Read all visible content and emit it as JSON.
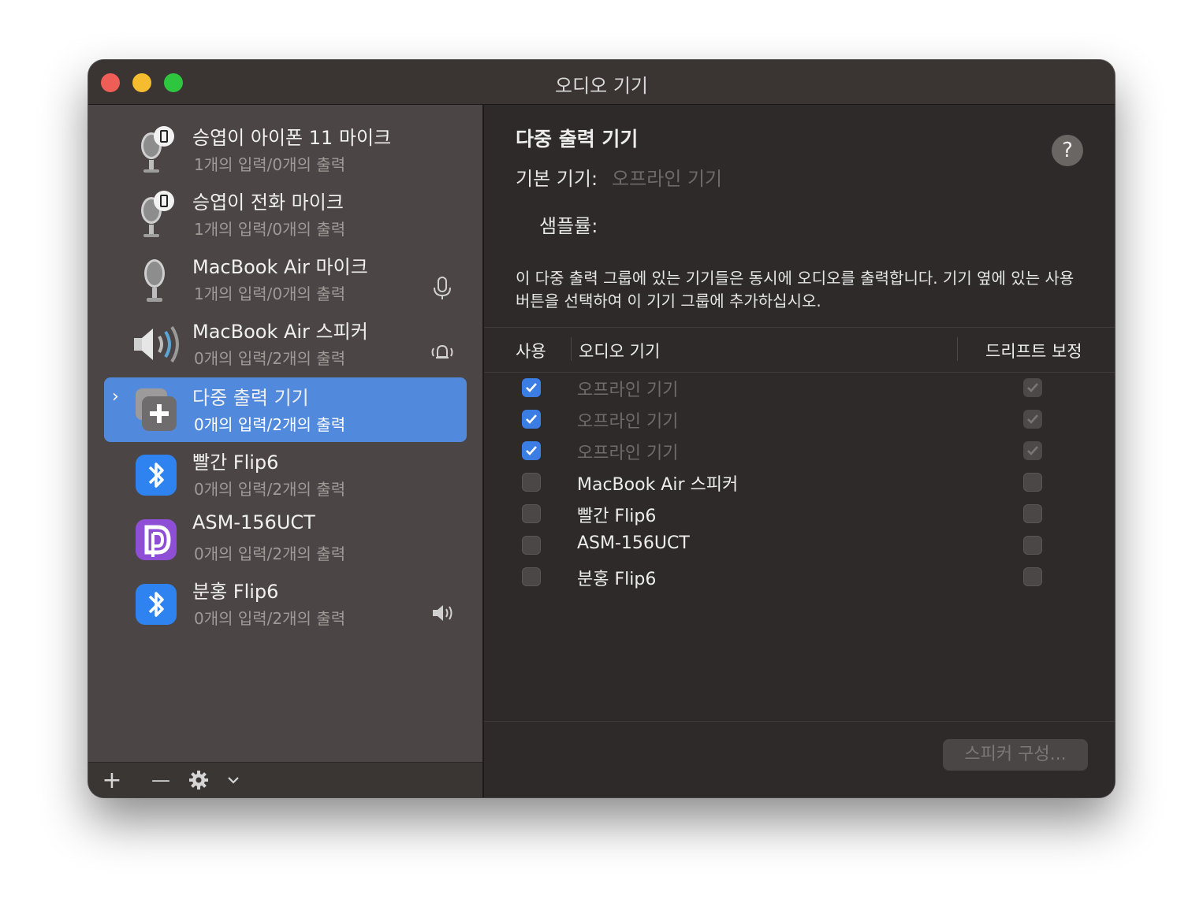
{
  "window": {
    "title": "오디오 기기"
  },
  "sidebar": {
    "devices": [
      {
        "name": "승엽이 아이폰 11 마이크",
        "io": "1개의 입력/0개의 출력",
        "icon": "iphone-microphone-icon"
      },
      {
        "name": "승엽이 전화 마이크",
        "io": "1개의 입력/0개의 출력",
        "icon": "iphone-microphone-icon"
      },
      {
        "name": "MacBook Air 마이크",
        "io": "1개의 입력/0개의 출력",
        "icon": "microphone-icon",
        "badge": "default-input-icon"
      },
      {
        "name": "MacBook Air 스피커",
        "io": "0개의 입력/2개의 출력",
        "icon": "speaker-icon",
        "badge": "system-output-bell-icon"
      },
      {
        "name": "다중 출력 기기",
        "io": "0개의 입력/2개의 출력",
        "icon": "multi-output-icon",
        "selected": true
      },
      {
        "name": "빨간 Flip6",
        "io": "0개의 입력/2개의 출력",
        "icon": "bluetooth-icon"
      },
      {
        "name": "ASM-156UCT",
        "io": "0개의 입력/2개의 출력",
        "icon": "dp-app-icon"
      },
      {
        "name": "분홍 Flip6",
        "io": "0개의 입력/2개의 출력",
        "icon": "bluetooth-icon",
        "badge": "default-output-speaker-icon"
      }
    ],
    "toolbar": {
      "add": "+",
      "remove": "—"
    }
  },
  "main": {
    "title": "다중 출력 기기",
    "help": "?",
    "primary_device_label": "기본 기기:",
    "primary_device_value": "오프라인 기기",
    "sample_rate_label": "샘플률:",
    "description": "이 다중 출력 그룹에 있는 기기들은 동시에 오디오를 출력합니다. 기기 옆에 있는 사용 버튼을 선택하여 이 기기 그룹에 추가하십시오.",
    "table": {
      "headers": {
        "use": "사용",
        "device": "오디오 기기",
        "drift": "드리프트 보정"
      },
      "rows": [
        {
          "name": "오프라인 기기",
          "use": true,
          "drift": true,
          "offline": true
        },
        {
          "name": "오프라인 기기",
          "use": true,
          "drift": true,
          "offline": true
        },
        {
          "name": "오프라인 기기",
          "use": true,
          "drift": true,
          "offline": true
        },
        {
          "name": "MacBook Air 스피커",
          "use": false,
          "drift": false,
          "offline": false
        },
        {
          "name": "빨간 Flip6",
          "use": false,
          "drift": false,
          "offline": false
        },
        {
          "name": "ASM-156UCT",
          "use": false,
          "drift": false,
          "offline": false
        },
        {
          "name": "분홍 Flip6",
          "use": false,
          "drift": false,
          "offline": false
        }
      ]
    },
    "speaker_config_button": "스피커 구성..."
  },
  "colors": {
    "accent": "#3b7ee3",
    "selection": "#5189dd",
    "sidebar_bg": "#4b4645",
    "window_bg": "#2d2a29"
  }
}
